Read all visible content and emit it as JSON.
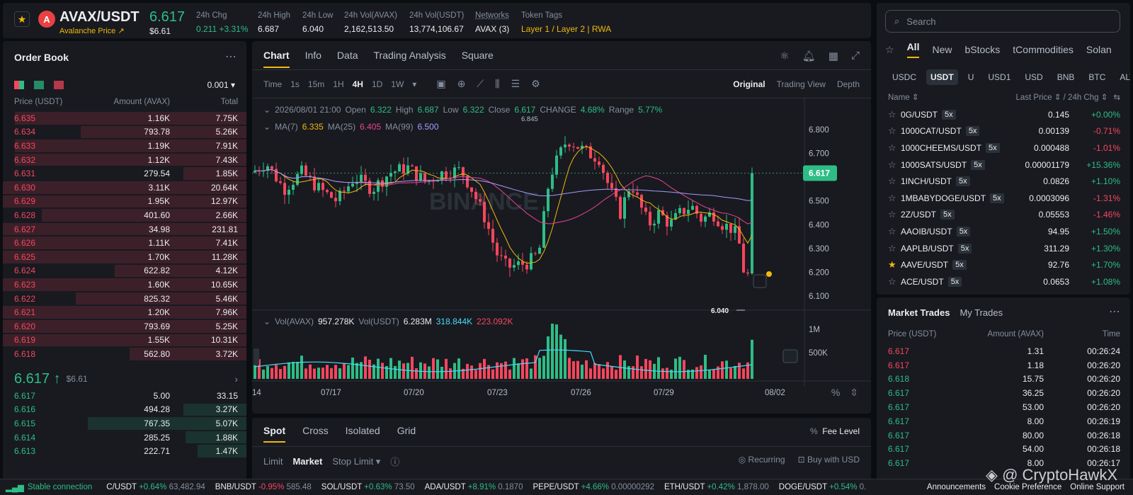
{
  "header": {
    "symbol": "AVAX/USDT",
    "sublink": "Avalanche Price ↗",
    "last_price": "6.617",
    "last_usd": "$6.61",
    "stats": [
      {
        "label": "24h Chg",
        "value": "0.211 +3.31%",
        "color": "#2ebd85"
      },
      {
        "label": "24h High",
        "value": "6.687"
      },
      {
        "label": "24h Low",
        "value": "6.040"
      },
      {
        "label": "24h Vol(AVAX)",
        "value": "2,162,513.50"
      },
      {
        "label": "24h Vol(USDT)",
        "value": "13,774,106.67"
      },
      {
        "label": "Networks",
        "value": "AVAX (3)"
      },
      {
        "label": "Token Tags",
        "value": "Layer 1 / Layer 2 | RWA",
        "color": "#f0b90b"
      }
    ]
  },
  "orderbook": {
    "title": "Order Book",
    "precision": "0.001 ▾",
    "columns": [
      "Price (USDT)",
      "Amount (AVAX)",
      "Total"
    ],
    "asks": [
      {
        "price": "6.635",
        "amount": "1.16K",
        "total": "7.75K",
        "depth": 0.95
      },
      {
        "price": "6.634",
        "amount": "793.78",
        "total": "5.26K",
        "depth": 0.68
      },
      {
        "price": "6.633",
        "amount": "1.19K",
        "total": "7.91K",
        "depth": 0.95
      },
      {
        "price": "6.632",
        "amount": "1.12K",
        "total": "7.43K",
        "depth": 0.95
      },
      {
        "price": "6.631",
        "amount": "279.54",
        "total": "1.85K",
        "depth": 0.26
      },
      {
        "price": "6.630",
        "amount": "3.11K",
        "total": "20.64K",
        "depth": 1.0
      },
      {
        "price": "6.629",
        "amount": "1.95K",
        "total": "12.97K",
        "depth": 1.0
      },
      {
        "price": "6.628",
        "amount": "401.60",
        "total": "2.66K",
        "depth": 0.84
      },
      {
        "price": "6.627",
        "amount": "34.98",
        "total": "231.81",
        "depth": 1.0
      },
      {
        "price": "6.626",
        "amount": "1.11K",
        "total": "7.41K",
        "depth": 1.0
      },
      {
        "price": "6.625",
        "amount": "1.70K",
        "total": "11.28K",
        "depth": 1.0
      },
      {
        "price": "6.624",
        "amount": "622.82",
        "total": "4.12K",
        "depth": 0.54
      },
      {
        "price": "6.623",
        "amount": "1.60K",
        "total": "10.65K",
        "depth": 1.0
      },
      {
        "price": "6.622",
        "amount": "825.32",
        "total": "5.46K",
        "depth": 0.7
      },
      {
        "price": "6.621",
        "amount": "1.20K",
        "total": "7.96K",
        "depth": 1.0
      },
      {
        "price": "6.620",
        "amount": "793.69",
        "total": "5.25K",
        "depth": 1.0
      },
      {
        "price": "6.619",
        "amount": "1.55K",
        "total": "10.31K",
        "depth": 1.0
      },
      {
        "price": "6.618",
        "amount": "562.80",
        "total": "3.72K",
        "depth": 0.48
      }
    ],
    "mid_price": "6.617 ↑",
    "mid_usd": "$6.61",
    "bids": [
      {
        "price": "6.617",
        "amount": "5.00",
        "total": "33.15",
        "depth": 0.0
      },
      {
        "price": "6.616",
        "amount": "494.28",
        "total": "3.27K",
        "depth": 0.26
      },
      {
        "price": "6.615",
        "amount": "767.35",
        "total": "5.07K",
        "depth": 0.65
      },
      {
        "price": "6.614",
        "amount": "285.25",
        "total": "1.88K",
        "depth": 0.25
      },
      {
        "price": "6.613",
        "amount": "222.71",
        "total": "1.47K",
        "depth": 0.2
      }
    ]
  },
  "chart": {
    "tabs": [
      "Chart",
      "Info",
      "Data",
      "Trading Analysis",
      "Square"
    ],
    "timeframes": [
      "Time",
      "1s",
      "15m",
      "1H",
      "4H",
      "1D",
      "1W"
    ],
    "active_timeframe": "4H",
    "views": [
      "Original",
      "Trading View",
      "Depth"
    ],
    "ohlc": {
      "date": "2026/08/01 21:00",
      "open": "6.322",
      "high": "6.687",
      "low": "6.322",
      "close": "6.617",
      "change": "4.68%",
      "range": "5.77%"
    },
    "ma": {
      "ma7_label": "MA(7)",
      "ma7": "6.335",
      "ma25_label": "MA(25)",
      "ma25": "6.405",
      "ma99_label": "MA(99)",
      "ma99": "6.500"
    },
    "vol": {
      "label": "Vol(AVAX)",
      "avax": "957.278K",
      "usdt_label": "Vol(USDT)",
      "usdt": "6.283M",
      "v1": "318.844K",
      "v2": "223.092K"
    },
    "price_ticks": [
      "6.800",
      "6.700",
      "6.600",
      "6.500",
      "6.400",
      "6.300",
      "6.200",
      "6.100"
    ],
    "vol_ticks": [
      "1M",
      "500K"
    ],
    "dates": [
      "14",
      "07/17",
      "07/20",
      "07/23",
      "07/26",
      "07/29",
      "08/02"
    ],
    "current_price": "6.617",
    "high_marker": "6.845",
    "low_marker": "6.040",
    "watermark": "BINANCE"
  },
  "chart_data": {
    "type": "candlestick",
    "title": "",
    "ylim": [
      6.04,
      6.845
    ],
    "y_ticks": [
      6.1,
      6.2,
      6.3,
      6.4,
      6.5,
      6.6,
      6.7,
      6.8
    ],
    "volume_ticks": [
      "500K",
      "1M"
    ],
    "x_labels": [
      "14",
      "07/17",
      "07/20",
      "07/23",
      "07/26",
      "07/29",
      "08/02"
    ],
    "last": {
      "open": 6.322,
      "high": 6.687,
      "low": 6.322,
      "close": 6.617
    }
  },
  "orderform": {
    "tabs": [
      "Spot",
      "Cross",
      "Isolated",
      "Grid"
    ],
    "fee": "Fee Level",
    "types": [
      "Limit",
      "Market",
      "Stop Limit ▾"
    ],
    "recurring": "Recurring",
    "buy_with": "Buy with USD"
  },
  "markets": {
    "search_placeholder": "Search",
    "tabs": [
      "All",
      "New",
      "bStocks",
      "tCommodities",
      "Solan"
    ],
    "quotes": [
      "USDC",
      "USDT",
      "U",
      "USD1",
      "USD",
      "BNB",
      "BTC",
      "ALT"
    ],
    "col_name": "Name ⇕",
    "col_price": "Last Price ⇕ / 24h Chg ⇕",
    "rows": [
      {
        "sym": "0G/USDT",
        "lev": "5x",
        "price": "0.145",
        "chg": "+0.00%",
        "dir": "up",
        "fav": false
      },
      {
        "sym": "1000CAT/USDT",
        "lev": "5x",
        "price": "0.00139",
        "chg": "-0.71%",
        "dir": "down",
        "fav": false
      },
      {
        "sym": "1000CHEEMS/USDT",
        "lev": "5x",
        "price": "0.000488",
        "chg": "-1.01%",
        "dir": "down",
        "fav": false
      },
      {
        "sym": "1000SATS/USDT",
        "lev": "5x",
        "price": "0.00001179",
        "chg": "+15.36%",
        "dir": "up",
        "fav": false
      },
      {
        "sym": "1INCH/USDT",
        "lev": "5x",
        "price": "0.0826",
        "chg": "+1.10%",
        "dir": "up",
        "fav": false
      },
      {
        "sym": "1MBABYDOGE/USDT",
        "lev": "5x",
        "price": "0.0003096",
        "chg": "-1.31%",
        "dir": "down",
        "fav": false
      },
      {
        "sym": "2Z/USDT",
        "lev": "5x",
        "price": "0.05553",
        "chg": "-1.46%",
        "dir": "down",
        "fav": false
      },
      {
        "sym": "AAOIB/USDT",
        "lev": "5x",
        "price": "94.95",
        "chg": "+1.50%",
        "dir": "up",
        "fav": false
      },
      {
        "sym": "AAPLB/USDT",
        "lev": "5x",
        "price": "311.29",
        "chg": "+1.30%",
        "dir": "up",
        "fav": false
      },
      {
        "sym": "AAVE/USDT",
        "lev": "5x",
        "price": "92.76",
        "chg": "+1.70%",
        "dir": "up",
        "fav": true
      },
      {
        "sym": "ACE/USDT",
        "lev": "5x",
        "price": "0.0653",
        "chg": "+1.08%",
        "dir": "up",
        "fav": false
      }
    ]
  },
  "trades": {
    "tabs": [
      "Market Trades",
      "My Trades"
    ],
    "columns": [
      "Price (USDT)",
      "Amount (AVAX)",
      "Time"
    ],
    "rows": [
      {
        "price": "6.617",
        "amount": "1.31",
        "time": "00:26:24",
        "dir": "down"
      },
      {
        "price": "6.617",
        "amount": "1.18",
        "time": "00:26:20",
        "dir": "down"
      },
      {
        "price": "6.618",
        "amount": "15.75",
        "time": "00:26:20",
        "dir": "up"
      },
      {
        "price": "6.617",
        "amount": "36.25",
        "time": "00:26:20",
        "dir": "up"
      },
      {
        "price": "6.617",
        "amount": "53.00",
        "time": "00:26:20",
        "dir": "up"
      },
      {
        "price": "6.617",
        "amount": "8.00",
        "time": "00:26:19",
        "dir": "up"
      },
      {
        "price": "6.617",
        "amount": "80.00",
        "time": "00:26:18",
        "dir": "up"
      },
      {
        "price": "6.617",
        "amount": "54.00",
        "time": "00:26:18",
        "dir": "up"
      },
      {
        "price": "6.617",
        "amount": "8.00",
        "time": "00:26:17",
        "dir": "up"
      }
    ]
  },
  "ticker": {
    "connection": "Stable connection",
    "items": [
      {
        "sym": "C/USDT",
        "chg": "+0.64%",
        "price": "63,482.94",
        "dir": "up"
      },
      {
        "sym": "BNB/USDT",
        "chg": "-0.95%",
        "price": "585.48",
        "dir": "down"
      },
      {
        "sym": "SOL/USDT",
        "chg": "+0.63%",
        "price": "73.50",
        "dir": "up"
      },
      {
        "sym": "ADA/USDT",
        "chg": "+8.91%",
        "price": "0.1870",
        "dir": "up"
      },
      {
        "sym": "PEPE/USDT",
        "chg": "+4.66%",
        "price": "0.00000292",
        "dir": "up"
      },
      {
        "sym": "ETH/USDT",
        "chg": "+0.42%",
        "price": "1,878.00",
        "dir": "up"
      },
      {
        "sym": "DOGE/USDT",
        "chg": "+0.54%",
        "price": "0.",
        "dir": "up"
      }
    ],
    "links": [
      "Announcements",
      "Cookie Preference",
      "Online Support"
    ]
  },
  "watermark_text": "@ CryptoHawkX",
  "colors": {
    "up": "#2ebd85",
    "down": "#f6465d",
    "accent": "#f0b90b",
    "bg": "#181a20"
  }
}
